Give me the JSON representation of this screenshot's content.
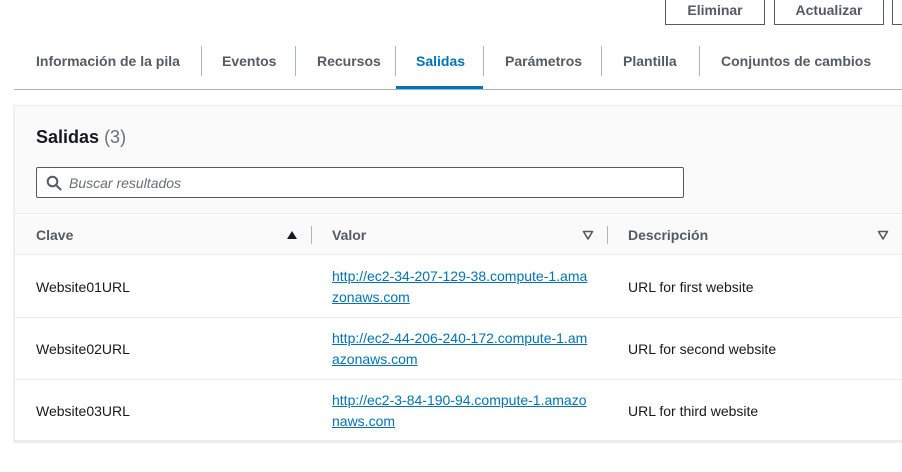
{
  "toolbar": {
    "delete_label": "Eliminar",
    "update_label": "Actualizar"
  },
  "tabs": [
    {
      "label": "Información de la pila",
      "active": false
    },
    {
      "label": "Eventos",
      "active": false
    },
    {
      "label": "Recursos",
      "active": false
    },
    {
      "label": "Salidas",
      "active": true
    },
    {
      "label": "Parámetros",
      "active": false
    },
    {
      "label": "Plantilla",
      "active": false
    },
    {
      "label": "Conjuntos de cambios",
      "active": false
    }
  ],
  "panel": {
    "title": "Salidas",
    "count": "(3)",
    "search_placeholder": "Buscar resultados"
  },
  "table": {
    "columns": [
      {
        "label": "Clave",
        "sort_icon": "sort-ascending-icon"
      },
      {
        "label": "Valor",
        "sort_icon": "sort-neutral-icon"
      },
      {
        "label": "Descripción",
        "sort_icon": "sort-neutral-icon"
      }
    ],
    "rows": [
      {
        "key": "Website01URL",
        "value": "http://ec2-34-207-129-38.compute-1.amazonaws.com",
        "description": "URL for first website"
      },
      {
        "key": "Website02URL",
        "value": "http://ec2-44-206-240-172.compute-1.amazonaws.com",
        "description": "URL for second website"
      },
      {
        "key": "Website03URL",
        "value": "http://ec2-3-84-190-94.compute-1.amazonaws.com",
        "description": "URL for third website"
      }
    ]
  },
  "colors": {
    "accent": "#0073bb",
    "text": "#16191f",
    "secondary_text": "#545b64"
  }
}
